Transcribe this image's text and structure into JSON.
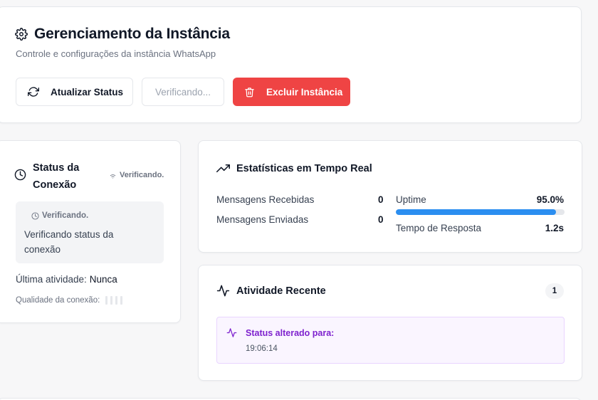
{
  "header": {
    "title": "Gerenciamento da Instância",
    "subtitle": "Controle e configurações da instância WhatsApp",
    "refresh_label": "Atualizar Status",
    "checking_label": "Verificando...",
    "delete_label": "Excluir Instância",
    "icons": {
      "title": "gear-icon",
      "refresh": "refresh-icon",
      "delete": "trash-icon"
    }
  },
  "connection": {
    "title": "Status da Conexão",
    "badge": "Verificando.",
    "box_head": "Verificando.",
    "box_message": "Verificando status da conexão",
    "last_activity_label": "Última atividade:",
    "last_activity_value": "Nunca",
    "quality_label": "Qualidade da conexão:",
    "quality_level": 0
  },
  "stats": {
    "title": "Estatísticas em Tempo Real",
    "received_label": "Mensagens Recebidas",
    "received_value": "0",
    "sent_label": "Mensagens Enviadas",
    "sent_value": "0",
    "uptime_label": "Uptime",
    "uptime_value": "95.0%",
    "uptime_fraction": 0.95,
    "response_label": "Tempo de Resposta",
    "response_value": "1.2s"
  },
  "activity": {
    "title": "Atividade Recente",
    "count": "1",
    "items": [
      {
        "text": "Status alterado para:",
        "time": "19:06:14"
      }
    ]
  },
  "colors": {
    "danger": "#ef4444",
    "progress": "#2b8ef0",
    "activity_accent": "#7e22ce",
    "activity_bg": "#faf5ff"
  }
}
